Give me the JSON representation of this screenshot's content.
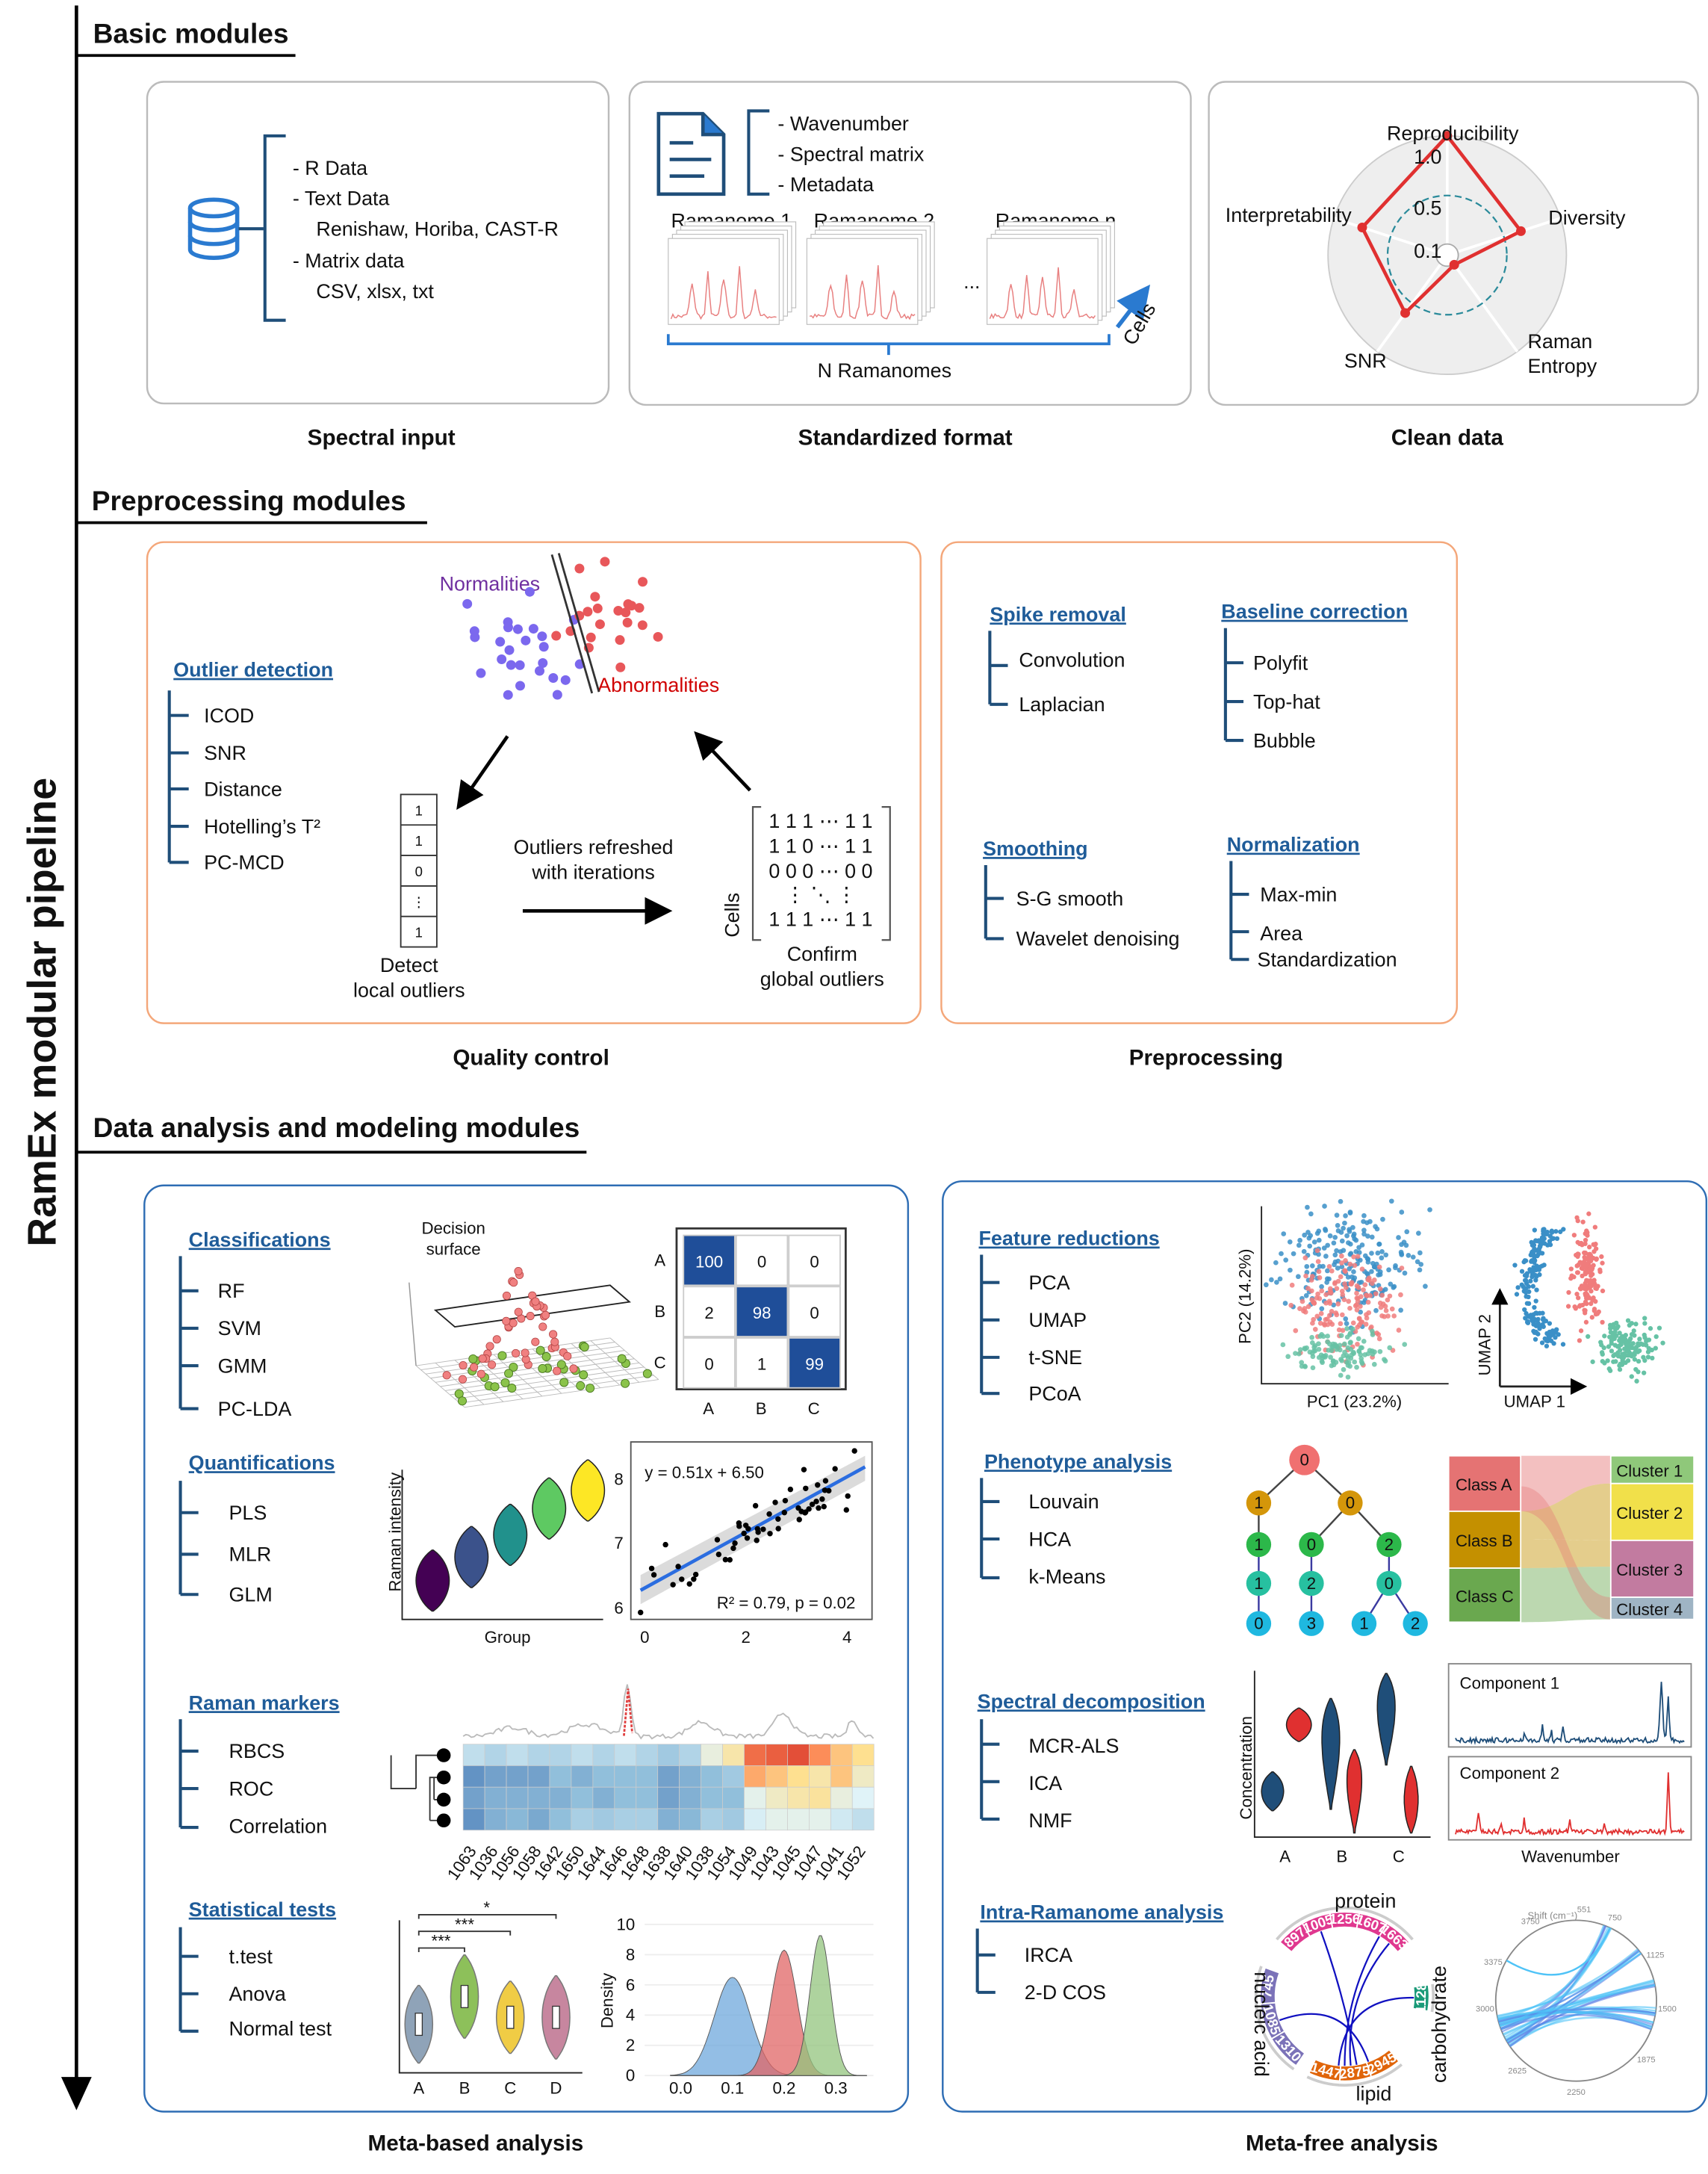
{
  "pipeline_title": "RamEx modular pipeline",
  "sections": {
    "basic": "Basic modules",
    "preprocessing": "Preprocessing modules",
    "analysis": "Data analysis and modeling modules"
  },
  "spectral_input": {
    "caption": "Spectral input",
    "items": [
      "- R Data",
      "- Text Data",
      "Renishaw, Horiba, CAST-R",
      "- Matrix data",
      "CSV, xlsx, txt"
    ]
  },
  "standardized_format": {
    "caption": "Standardized format",
    "fields": [
      "- Wavenumber",
      "- Spectral matrix",
      "- Metadata"
    ],
    "ramanomes": [
      "Ramanome 1",
      "Ramanome 2",
      "Ramanome n"
    ],
    "ellipsis": "...",
    "n_label": "N Ramanomes",
    "cells_label": "Cells"
  },
  "clean_data": {
    "caption": "Clean data",
    "axes": [
      {
        "label": "Reproducibility",
        "value": 1.0
      },
      {
        "label": "Diversity",
        "value": 0.65
      },
      {
        "label": "Raman",
        "label2": "Entropy",
        "value": 0.1
      },
      {
        "label": "SNR",
        "value": 0.6
      },
      {
        "label": "Interpretability",
        "value": 0.75
      }
    ],
    "ticks": [
      "1.0",
      "0.5",
      "0.1"
    ],
    "line_color": "#e03030",
    "ring_color": "#2a8a9a"
  },
  "quality_control": {
    "caption": "Quality control",
    "normalities": "Normalities",
    "abnormalities": "Abnormalities",
    "normal_color": "#7b68ee",
    "abnormal_color": "#e8575a",
    "outlier_header": "Outlier detection",
    "outlier_methods": [
      "ICOD",
      "SNR",
      "Distance",
      "Hotelling’s T²",
      "PC-MCD"
    ],
    "vector": [
      "1",
      "1",
      "0",
      "⋮",
      "1"
    ],
    "local_label": [
      "Detect",
      "local outliers"
    ],
    "iter_label": [
      "Outliers refreshed",
      "with iterations"
    ],
    "matrix_rows": [
      "1 1 1 ⋯ 1 1",
      "1 1 0 ⋯ 1 1",
      "0 0 0 ⋯ 0 0",
      "⋮      ⋱      ⋮",
      "1 1 1 ⋯ 1 1"
    ],
    "cells_label": "Cells",
    "global_label": [
      "Confirm",
      "global outliers"
    ]
  },
  "preprocessing": {
    "caption": "Preprocessing",
    "spike": {
      "header": "Spike removal",
      "items": [
        "Convolution",
        "Laplacian"
      ]
    },
    "baseline": {
      "header": "Baseline correction",
      "items": [
        "Polyfit",
        "Top-hat",
        "Bubble"
      ]
    },
    "smoothing": {
      "header": "Smoothing",
      "items": [
        "S-G smooth",
        "Wavelet denoising"
      ]
    },
    "normalization": {
      "header": "Normalization",
      "items": [
        "Max-min",
        "Area",
        "Standardization"
      ]
    }
  },
  "meta_based": {
    "caption": "Meta-based analysis",
    "classifications": {
      "header": "Classifications",
      "items": [
        "RF",
        "SVM",
        "GMM",
        "PC-LDA"
      ],
      "surface_label": [
        "Decision",
        "surface"
      ],
      "confusion": {
        "labels": [
          "A",
          "B",
          "C"
        ],
        "values": [
          [
            "100",
            "0",
            "0"
          ],
          [
            "2",
            "98",
            "0"
          ],
          [
            "0",
            "1",
            "99"
          ]
        ],
        "diag_color": "#1f4e99"
      }
    },
    "quantifications": {
      "header": "Quantifications",
      "items": [
        "PLS",
        "MLR",
        "GLM"
      ],
      "violin_ylabel": "Raman intensity",
      "violin_xlabel": "Group",
      "violin_colors": [
        "#440154",
        "#3b528b",
        "#21918c",
        "#5ec962",
        "#fde725"
      ],
      "regression": {
        "equation": "y = 0.51x + 6.50",
        "stats": "R² = 0.79, p = 0.02",
        "yticks": [
          "8",
          "7",
          "6"
        ],
        "xticks": [
          "0",
          "2",
          "4"
        ],
        "line_color": "#2b6de0"
      }
    },
    "raman_markers": {
      "header": "Raman markers",
      "items": [
        "RBCS",
        "ROC",
        "Correlation"
      ],
      "wavenumbers": [
        "1063",
        "1036",
        "1056",
        "1058",
        "1642",
        "1650",
        "1644",
        "1646",
        "1648",
        "1638",
        "1640",
        "1038",
        "1054",
        "1049",
        "1043",
        "1045",
        "1047",
        "1041",
        "1052"
      ]
    },
    "statistical_tests": {
      "header": "Statistical tests",
      "items": [
        "t.test",
        "Anova",
        "Normal test"
      ],
      "groups": [
        "A",
        "B",
        "C",
        "D"
      ],
      "group_colors": [
        "#8fa3b8",
        "#8dc05a",
        "#f0cc45",
        "#c7869f"
      ],
      "significance": [
        "*",
        "***",
        "***"
      ],
      "density": {
        "ylabel": "Density",
        "yticks": [
          "10",
          "8",
          "6",
          "4",
          "2",
          "0"
        ],
        "xticks": [
          "0.0",
          "0.1",
          "0.2",
          "0.3"
        ],
        "series": [
          {
            "mean": 0.1,
            "peak": 6.5,
            "color": "#6fa8dc"
          },
          {
            "mean": 0.2,
            "peak": 8.3,
            "color": "#e06666"
          },
          {
            "mean": 0.27,
            "peak": 9.3,
            "color": "#93c47d"
          }
        ]
      }
    }
  },
  "meta_free": {
    "caption": "Meta-free analysis",
    "feature_reductions": {
      "header": "Feature reductions",
      "items": [
        "PCA",
        "UMAP",
        "t-SNE",
        "PCoA"
      ],
      "pca_x": "PC1 (23.2%)",
      "pca_y": "PC2 (14.2%)",
      "umap_x": "UMAP 1",
      "umap_y": "UMAP 2",
      "colors": [
        "#3a8fc7",
        "#f07c7c",
        "#66c2a5"
      ]
    },
    "phenotype": {
      "header": "Phenotype analysis",
      "items": [
        "Louvain",
        "HCA",
        "k-Means"
      ],
      "tree_levels": [
        [
          "0"
        ],
        [
          "1",
          "0"
        ],
        [
          "1",
          "0",
          "2"
        ],
        [
          "1",
          "2",
          "0"
        ],
        [
          "0",
          "3",
          "1",
          "2"
        ]
      ],
      "tree_colors": [
        "#f07070",
        "#d4960a",
        "#2cb84a",
        "#27c0a0",
        "#1fb8e0"
      ],
      "classes": [
        "Class A",
        "Class B",
        "Class C"
      ],
      "class_colors": [
        "#e57373",
        "#c49000",
        "#6aa84f"
      ],
      "clusters": [
        "Cluster 1",
        "Cluster 2",
        "Cluster 3",
        "Cluster 4"
      ],
      "cluster_colors": [
        "#8fc87a",
        "#f1e04a",
        "#c27ba0",
        "#9fb4c4"
      ]
    },
    "spectral_decomposition": {
      "header": "Spectral decomposition",
      "items": [
        "MCR-ALS",
        "ICA",
        "NMF"
      ],
      "ylabel": "Concentration",
      "groups": [
        "A",
        "B",
        "C"
      ],
      "components": [
        "Component 1",
        "Component 2"
      ],
      "xlabel": "Wavenumber",
      "colors": [
        "#1f4e79",
        "#e03030"
      ]
    },
    "intra_ramanome": {
      "header": "Intra-Ramanome analysis",
      "items": [
        "IRCA",
        "2-D COS"
      ],
      "circos": {
        "protein": {
          "label": "protein",
          "peaks": [
            "897",
            "1005",
            "1256",
            "1607",
            "1663"
          ],
          "color": "#e0388f"
        },
        "nucleic_acid": {
          "label": "nucleic acid",
          "peaks": [
            "1310",
            "1085",
            "745"
          ],
          "color": "#7b72b8"
        },
        "carbohydrate": {
          "label": "carbohydrate",
          "peaks": [
            "1128"
          ],
          "color": "#1a9a78"
        },
        "lipid": {
          "label": "lipid",
          "peaks": [
            "2945",
            "2875",
            "1447"
          ],
          "color": "#e0650a"
        }
      },
      "chord": {
        "title": "Shift (cm⁻¹)",
        "ticks": [
          "551",
          "750",
          "1125",
          "1500",
          "1875",
          "2250",
          "2625",
          "3000",
          "3375",
          "3750"
        ]
      }
    }
  }
}
